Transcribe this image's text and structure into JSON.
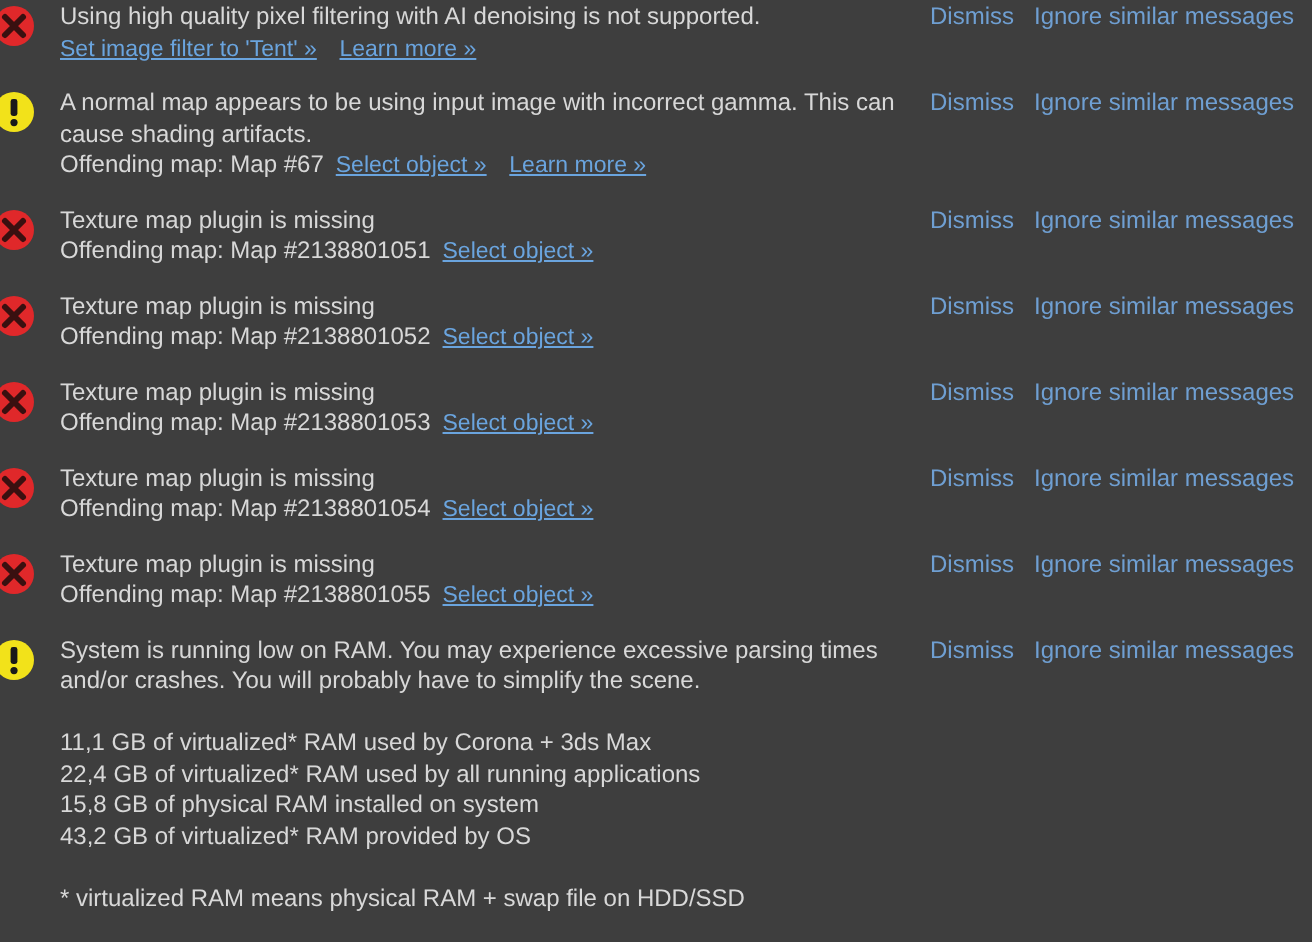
{
  "messages": [
    {
      "kind": "error",
      "paragraphs": [
        {
          "lines": [
            {
              "text": "Using high quality pixel filtering with AI denoising is not supported.",
              "links": [
                "Set image filter to 'Tent' »",
                "Learn more »"
              ]
            }
          ]
        }
      ],
      "actions": [
        "Dismiss",
        "Ignore similar messages"
      ]
    },
    {
      "kind": "warning",
      "paragraphs": [
        {
          "lines": [
            {
              "text": "A normal map appears to be using input image with incorrect gamma. This can cause shading artifacts."
            },
            {
              "text": "Offending map: Map #67",
              "links": [
                "Select object »",
                "Learn more »"
              ]
            }
          ]
        }
      ],
      "actions": [
        "Dismiss",
        "Ignore similar messages"
      ]
    },
    {
      "kind": "error",
      "paragraphs": [
        {
          "lines": [
            {
              "text": "Texture map plugin is missing"
            },
            {
              "text": "Offending map: Map #2138801051",
              "links": [
                "Select object »"
              ]
            }
          ]
        }
      ],
      "actions": [
        "Dismiss",
        "Ignore similar messages"
      ]
    },
    {
      "kind": "error",
      "paragraphs": [
        {
          "lines": [
            {
              "text": "Texture map plugin is missing"
            },
            {
              "text": "Offending map: Map #2138801052",
              "links": [
                "Select object »"
              ]
            }
          ]
        }
      ],
      "actions": [
        "Dismiss",
        "Ignore similar messages"
      ]
    },
    {
      "kind": "error",
      "paragraphs": [
        {
          "lines": [
            {
              "text": "Texture map plugin is missing"
            },
            {
              "text": "Offending map: Map #2138801053",
              "links": [
                "Select object »"
              ]
            }
          ]
        }
      ],
      "actions": [
        "Dismiss",
        "Ignore similar messages"
      ]
    },
    {
      "kind": "error",
      "paragraphs": [
        {
          "lines": [
            {
              "text": "Texture map plugin is missing"
            },
            {
              "text": "Offending map: Map #2138801054",
              "links": [
                "Select object »"
              ]
            }
          ]
        }
      ],
      "actions": [
        "Dismiss",
        "Ignore similar messages"
      ]
    },
    {
      "kind": "error",
      "paragraphs": [
        {
          "lines": [
            {
              "text": "Texture map plugin is missing"
            },
            {
              "text": "Offending map: Map #2138801055",
              "links": [
                "Select object »"
              ]
            }
          ]
        }
      ],
      "actions": [
        "Dismiss",
        "Ignore similar messages"
      ]
    },
    {
      "kind": "warning",
      "paragraphs": [
        {
          "lines": [
            {
              "text": "System is running low on RAM. You may experience excessive parsing times and/or crashes. You will probably have to simplify the scene."
            }
          ]
        },
        {
          "lines": [
            {
              "text": "11,1 GB of virtualized* RAM used by Corona + 3ds Max"
            },
            {
              "text": "22,4 GB of virtualized* RAM used by all running applications"
            },
            {
              "text": "15,8 GB of physical RAM installed on system"
            },
            {
              "text": "43,2 GB of virtualized* RAM provided by OS"
            }
          ]
        },
        {
          "lines": [
            {
              "text": "* virtualized RAM means physical RAM + swap file on HDD/SSD"
            }
          ]
        }
      ],
      "actions": [
        "Dismiss",
        "Ignore similar messages"
      ]
    }
  ]
}
